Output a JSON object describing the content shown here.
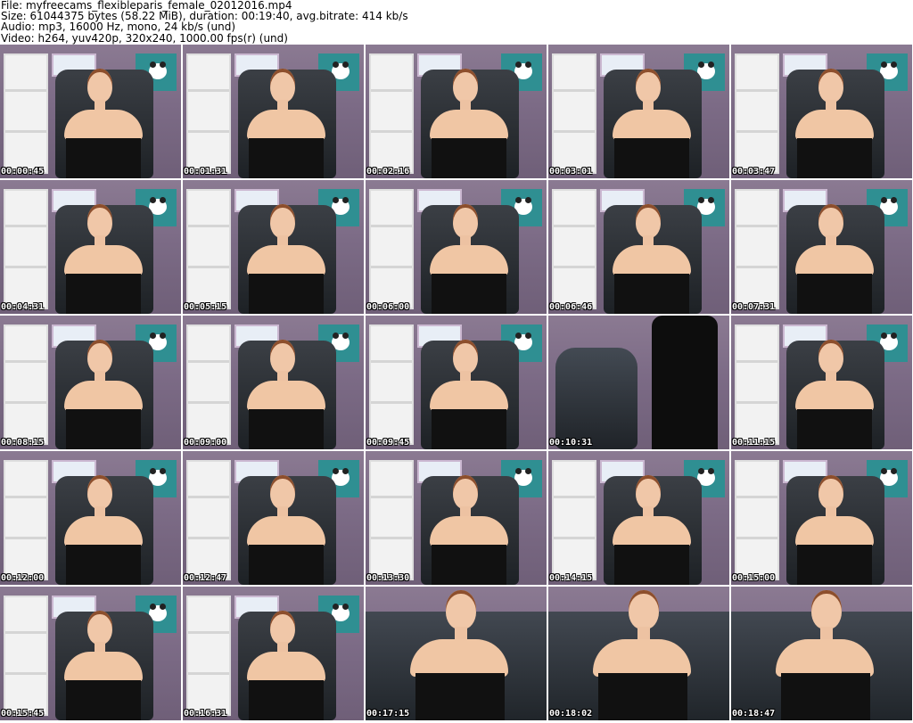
{
  "header": {
    "line1": "File: myfreecams_flexibleparis_female_02012016.mp4",
    "line2": "Size: 61044375 bytes (58.22 MiB), duration: 00:19:40, avg.bitrate: 414 kb/s",
    "line3": "Audio: mp3, 16000 Hz, mono, 24 kb/s (und)",
    "line4": "Video: h264, yuv420p, 320x240, 1000.00 fps(r) (und)"
  },
  "thumbnails": [
    {
      "time": "00:00:45",
      "variant": "standard"
    },
    {
      "time": "00:01:31",
      "variant": "standard"
    },
    {
      "time": "00:02:16",
      "variant": "standard"
    },
    {
      "time": "00:03:01",
      "variant": "standard"
    },
    {
      "time": "00:03:47",
      "variant": "standard"
    },
    {
      "time": "00:04:31",
      "variant": "standard"
    },
    {
      "time": "00:05:15",
      "variant": "standard"
    },
    {
      "time": "00:06:00",
      "variant": "standard"
    },
    {
      "time": "00:06:46",
      "variant": "standard"
    },
    {
      "time": "00:07:31",
      "variant": "standard"
    },
    {
      "time": "00:08:15",
      "variant": "standard"
    },
    {
      "time": "00:09:00",
      "variant": "standard"
    },
    {
      "time": "00:09:45",
      "variant": "standard"
    },
    {
      "time": "00:10:31",
      "variant": "empty"
    },
    {
      "time": "00:11:15",
      "variant": "standard"
    },
    {
      "time": "00:12:00",
      "variant": "standard"
    },
    {
      "time": "00:12:47",
      "variant": "standard"
    },
    {
      "time": "00:13:30",
      "variant": "standard"
    },
    {
      "time": "00:14:15",
      "variant": "standard"
    },
    {
      "time": "00:15:00",
      "variant": "standard"
    },
    {
      "time": "00:15:45",
      "variant": "standard"
    },
    {
      "time": "00:16:31",
      "variant": "standard"
    },
    {
      "time": "00:17:15",
      "variant": "closeup"
    },
    {
      "time": "00:18:02",
      "variant": "closeup"
    },
    {
      "time": "00:18:47",
      "variant": "closeup"
    }
  ]
}
